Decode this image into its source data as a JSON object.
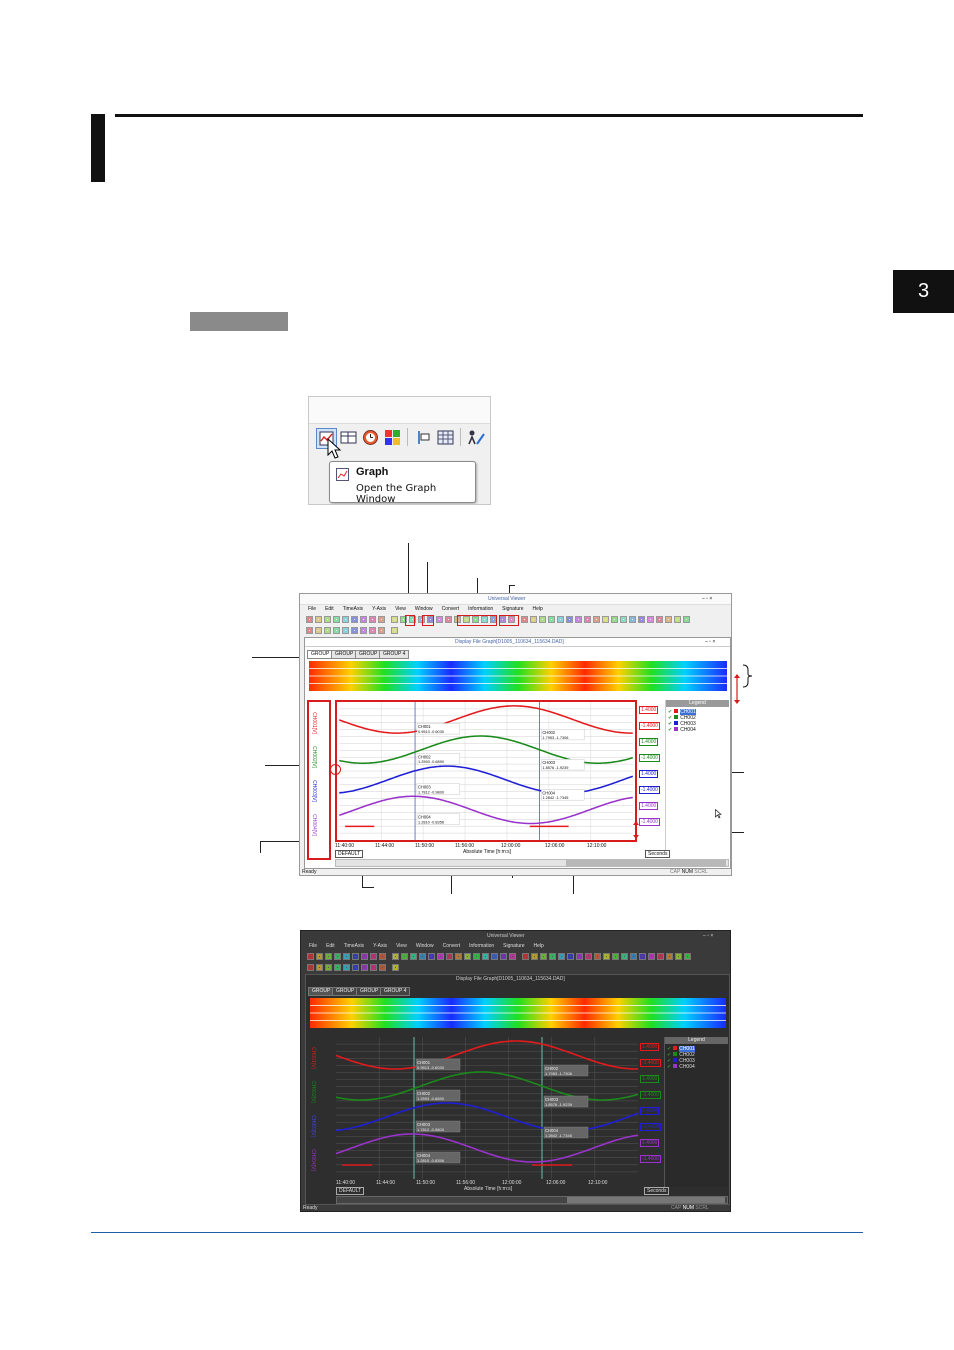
{
  "chapter_tab": {
    "number": "3"
  },
  "section_label": "",
  "snippet": {
    "tooltip_title": "Graph",
    "tooltip_desc": "Open the Graph Window"
  },
  "app1": {
    "title": "Universal Viewer",
    "menu": [
      "File",
      "Edit",
      "TimeAxis",
      "Y-Axis",
      "View",
      "Window",
      "Convert",
      "Information",
      "Signature",
      "Help"
    ],
    "doc_title": "Display File Graph[D1005_110634_115634.DAD]",
    "tabs": [
      "GROUP 1",
      "GROUP 2",
      "GROUP 3",
      "GROUP 4"
    ],
    "legend_title": "Legend",
    "legend_items": [
      "CH001",
      "CH002",
      "CH003",
      "CH004"
    ],
    "y_axis_labels": [
      "CH001[V]",
      "CH002[V]",
      "CH003[V]",
      "CH004[V]"
    ],
    "x_ticks": [
      "11:40:00",
      "11:44:00",
      "11:50:00",
      "11:56:00",
      "12:00:00",
      "12:06:00",
      "12:10:00"
    ],
    "x_axis_label": "Absolute Time [h:m:s]",
    "left_box": "DEFAULT",
    "right_box": "Seconds",
    "status": "Ready",
    "status_right": [
      "CAP",
      "NUM",
      "SCRL"
    ],
    "scale_values": [
      "1.4000",
      "-1.4000",
      "1.4000",
      "-1.4000",
      "1.4000",
      "-1.4000",
      "1.4000",
      "-1.4000"
    ],
    "cursor_labels": [
      {
        "ch": "CH001",
        "a": "0.9513",
        "b": "-0.6030"
      },
      {
        "ch": "CH002",
        "a": "1.2593",
        "b": "-0.6890"
      },
      {
        "ch": "CH003",
        "a": "1.7812",
        "b": "-0.9800"
      },
      {
        "ch": "CH004",
        "a": "1.2810",
        "b": "-0.8356"
      }
    ],
    "cursor_labels_b": [
      {
        "ch": "CH002",
        "a": "1.7953",
        "b": "-1.7306"
      },
      {
        "ch": "CH003",
        "a": "1.8576",
        "b": "-1.9239"
      },
      {
        "ch": "CH004",
        "a": "1.2842",
        "b": "-1.7345"
      }
    ]
  },
  "colors": {
    "ch1": "#e41a1c",
    "ch2": "#1a8a1a",
    "ch3": "#1f1fd6",
    "ch4": "#9a33cc",
    "highlight": "#d81b1b",
    "dark_bg": "#3a3a3a",
    "footer_rule": "#1f5fa8"
  }
}
